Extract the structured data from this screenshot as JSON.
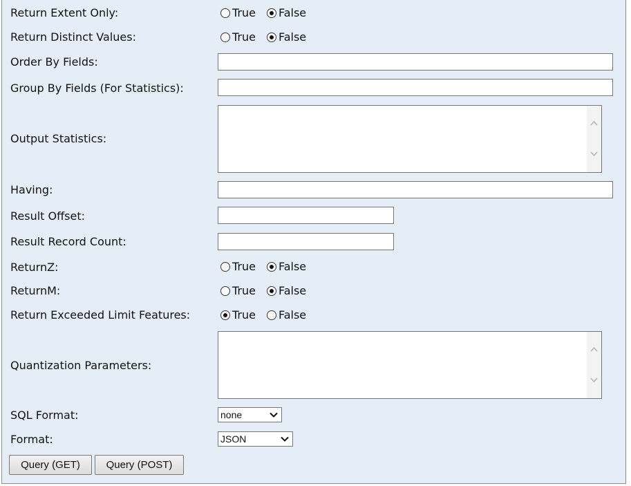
{
  "fields": {
    "return_extent_only": {
      "label": "Return Extent Only:",
      "options": [
        "True",
        "False"
      ],
      "selected": "False"
    },
    "return_distinct_values": {
      "label": "Return Distinct Values:",
      "options": [
        "True",
        "False"
      ],
      "selected": "False"
    },
    "order_by_fields": {
      "label": "Order By Fields:",
      "value": ""
    },
    "group_by_fields": {
      "label": "Group By Fields (For Statistics):",
      "value": ""
    },
    "output_statistics": {
      "label": "Output Statistics:",
      "value": ""
    },
    "having": {
      "label": "Having:",
      "value": ""
    },
    "result_offset": {
      "label": "Result Offset:",
      "value": ""
    },
    "result_record_count": {
      "label": "Result Record Count:",
      "value": ""
    },
    "return_z": {
      "label": "ReturnZ:",
      "options": [
        "True",
        "False"
      ],
      "selected": "False"
    },
    "return_m": {
      "label": "ReturnM:",
      "options": [
        "True",
        "False"
      ],
      "selected": "False"
    },
    "return_exceeded_limit_features": {
      "label": "Return Exceeded Limit Features:",
      "options": [
        "True",
        "False"
      ],
      "selected": "True"
    },
    "quantization_parameters": {
      "label": "Quantization Parameters:",
      "value": ""
    },
    "sql_format": {
      "label": "SQL Format:",
      "selected": "none"
    },
    "format": {
      "label": "Format:",
      "selected": "JSON"
    }
  },
  "buttons": {
    "query_get": "Query (GET)",
    "query_post": "Query (POST)"
  },
  "icons": {
    "scroll_up": "chevron-up-icon",
    "scroll_down": "chevron-down-icon",
    "dropdown": "chevron-down-icon"
  }
}
